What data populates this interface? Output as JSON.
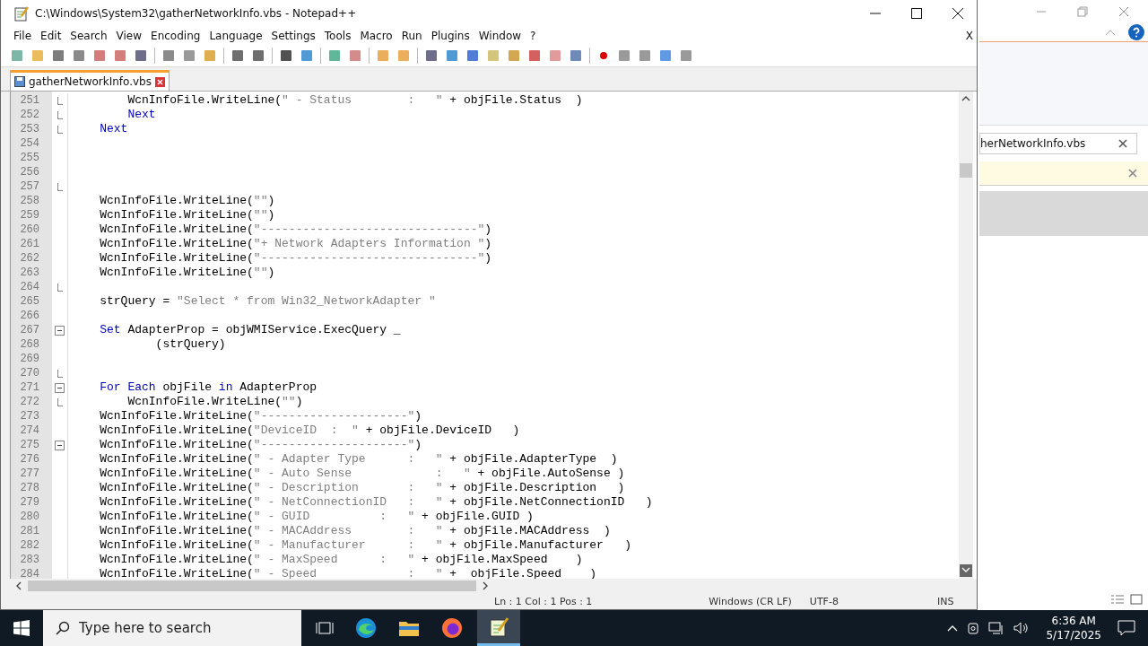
{
  "window": {
    "title": "C:\\Windows\\System32\\gatherNetworkInfo.vbs - Notepad++"
  },
  "menu": [
    "File",
    "Edit",
    "Search",
    "View",
    "Encoding",
    "Language",
    "Settings",
    "Tools",
    "Macro",
    "Run",
    "Plugins",
    "Window",
    "?"
  ],
  "menu_close": "X",
  "tabs": [
    {
      "label": "gatherNetworkInfo.vbs",
      "selected": true
    }
  ],
  "lines": [
    {
      "number": "251",
      "kind": "foldend",
      "tokens": [
        {
          "kind": "plain",
          "text": "        WcnInfoFile.WriteLine("
        },
        {
          "kind": "string",
          "text": "\" - Status        :   \""
        },
        {
          "kind": "plain",
          "text": " + objFile.Status  )"
        }
      ]
    },
    {
      "number": "252",
      "kind": "foldend",
      "tokens": [
        {
          "kind": "keyword",
          "text": "        Next"
        }
      ]
    },
    {
      "number": "253",
      "kind": "foldend",
      "tokens": [
        {
          "kind": "keyword",
          "text": "    Next"
        }
      ]
    },
    {
      "number": "254"
    },
    {
      "number": "255"
    },
    {
      "number": "256"
    },
    {
      "number": "257",
      "kind": "foldend"
    },
    {
      "number": "258",
      "tokens": [
        {
          "kind": "plain",
          "text": "    WcnInfoFile.WriteLine("
        },
        {
          "kind": "string",
          "text": "\"\""
        },
        {
          "kind": "plain",
          "text": ")"
        }
      ]
    },
    {
      "number": "259",
      "tokens": [
        {
          "kind": "plain",
          "text": "    WcnInfoFile.WriteLine("
        },
        {
          "kind": "string",
          "text": "\"\""
        },
        {
          "kind": "plain",
          "text": ")"
        }
      ]
    },
    {
      "number": "260",
      "tokens": [
        {
          "kind": "plain",
          "text": "    WcnInfoFile.WriteLine("
        },
        {
          "kind": "string",
          "text": "\"-------------------------------\""
        },
        {
          "kind": "plain",
          "text": ")"
        }
      ]
    },
    {
      "number": "261",
      "tokens": [
        {
          "kind": "plain",
          "text": "    WcnInfoFile.WriteLine("
        },
        {
          "kind": "string",
          "text": "\"+ Network Adapters Information \""
        },
        {
          "kind": "plain",
          "text": ")"
        }
      ]
    },
    {
      "number": "262",
      "tokens": [
        {
          "kind": "plain",
          "text": "    WcnInfoFile.WriteLine("
        },
        {
          "kind": "string",
          "text": "\"-------------------------------\""
        },
        {
          "kind": "plain",
          "text": ")"
        }
      ]
    },
    {
      "number": "263",
      "tokens": [
        {
          "kind": "plain",
          "text": "    WcnInfoFile.WriteLine("
        },
        {
          "kind": "string",
          "text": "\"\""
        },
        {
          "kind": "plain",
          "text": ")"
        }
      ]
    },
    {
      "number": "264",
      "kind": "foldend"
    },
    {
      "number": "265",
      "tokens": [
        {
          "kind": "plain",
          "text": "    strQuery = "
        },
        {
          "kind": "string",
          "text": "\"Select * from Win32_NetworkAdapter \""
        }
      ]
    },
    {
      "number": "266"
    },
    {
      "number": "267",
      "kind": "foldstart",
      "tokens": [
        {
          "kind": "keyword",
          "text": "    Set"
        },
        {
          "kind": "plain",
          "text": " AdapterProp = objWMIService.ExecQuery _"
        }
      ]
    },
    {
      "number": "268",
      "tokens": [
        {
          "kind": "plain",
          "text": "            (strQuery)"
        }
      ]
    },
    {
      "number": "269"
    },
    {
      "number": "270",
      "kind": "foldend"
    },
    {
      "number": "271",
      "kind": "foldstart",
      "tokens": [
        {
          "kind": "keyword",
          "text": "    For Each"
        },
        {
          "kind": "plain",
          "text": " objFile "
        },
        {
          "kind": "keyword",
          "text": "in"
        },
        {
          "kind": "plain",
          "text": " AdapterProp"
        }
      ]
    },
    {
      "number": "272",
      "kind": "foldend",
      "tokens": [
        {
          "kind": "plain",
          "text": "        WcnInfoFile.WriteLine("
        },
        {
          "kind": "string",
          "text": "\"\""
        },
        {
          "kind": "plain",
          "text": ")"
        }
      ]
    },
    {
      "number": "273",
      "tokens": [
        {
          "kind": "plain",
          "text": "    WcnInfoFile.WriteLine("
        },
        {
          "kind": "string",
          "text": "\"---------------------\""
        },
        {
          "kind": "plain",
          "text": ")"
        }
      ]
    },
    {
      "number": "274",
      "tokens": [
        {
          "kind": "plain",
          "text": "    WcnInfoFile.WriteLine("
        },
        {
          "kind": "string",
          "text": "\"DeviceID  :  \""
        },
        {
          "kind": "plain",
          "text": " + objFile.DeviceID   )"
        }
      ]
    },
    {
      "number": "275",
      "kind": "foldstart",
      "tokens": [
        {
          "kind": "plain",
          "text": "    WcnInfoFile.WriteLine("
        },
        {
          "kind": "string",
          "text": "\"---------------------\""
        },
        {
          "kind": "plain",
          "text": ")"
        }
      ]
    },
    {
      "number": "276",
      "tokens": [
        {
          "kind": "plain",
          "text": "    WcnInfoFile.WriteLine("
        },
        {
          "kind": "string",
          "text": "\" - Adapter Type      :   \""
        },
        {
          "kind": "plain",
          "text": " + objFile.AdapterType  )"
        }
      ]
    },
    {
      "number": "277",
      "tokens": [
        {
          "kind": "plain",
          "text": "    WcnInfoFile.WriteLine("
        },
        {
          "kind": "string",
          "text": "\" - Auto Sense            :   \""
        },
        {
          "kind": "plain",
          "text": " + objFile.AutoSense )"
        }
      ]
    },
    {
      "number": "278",
      "tokens": [
        {
          "kind": "plain",
          "text": "    WcnInfoFile.WriteLine("
        },
        {
          "kind": "string",
          "text": "\" - Description       :   \""
        },
        {
          "kind": "plain",
          "text": " + objFile.Description   )"
        }
      ]
    },
    {
      "number": "279",
      "tokens": [
        {
          "kind": "plain",
          "text": "    WcnInfoFile.WriteLine("
        },
        {
          "kind": "string",
          "text": "\" - NetConnectionID   :   \""
        },
        {
          "kind": "plain",
          "text": " + objFile.NetConnectionID   )"
        }
      ]
    },
    {
      "number": "280",
      "tokens": [
        {
          "kind": "plain",
          "text": "    WcnInfoFile.WriteLine("
        },
        {
          "kind": "string",
          "text": "\" - GUID          :   \""
        },
        {
          "kind": "plain",
          "text": " + objFile.GUID )"
        }
      ]
    },
    {
      "number": "281",
      "tokens": [
        {
          "kind": "plain",
          "text": "    WcnInfoFile.WriteLine("
        },
        {
          "kind": "string",
          "text": "\" - MACAddress        :   \""
        },
        {
          "kind": "plain",
          "text": " + objFile.MACAddress  )"
        }
      ]
    },
    {
      "number": "282",
      "tokens": [
        {
          "kind": "plain",
          "text": "    WcnInfoFile.WriteLine("
        },
        {
          "kind": "string",
          "text": "\" - Manufacturer      :   \""
        },
        {
          "kind": "plain",
          "text": " + objFile.Manufacturer   )"
        }
      ]
    },
    {
      "number": "283",
      "tokens": [
        {
          "kind": "plain",
          "text": "    WcnInfoFile.WriteLine("
        },
        {
          "kind": "string",
          "text": "\" - MaxSpeed      :   \""
        },
        {
          "kind": "plain",
          "text": " + objFile.MaxSpeed    )"
        }
      ]
    },
    {
      "number": "284",
      "tokens": [
        {
          "kind": "plain",
          "text": "    WcnInfoFile.WriteLine("
        },
        {
          "kind": "string",
          "text": "\" - Speed             :   \""
        },
        {
          "kind": "plain",
          "text": " +  objFile.Speed    )"
        }
      ]
    }
  ],
  "status_bar": [
    "Ln : 1    Col : 1    Pos : 1",
    "Windows (CR LF)",
    "UTF-8",
    "INS"
  ],
  "background_window": {
    "tab": "herNetworkInfo.vbs"
  },
  "taskbar": {
    "search": {
      "placeholder": "Type here to search"
    },
    "time": "6:36 AM",
    "date": "5/17/2025"
  }
}
